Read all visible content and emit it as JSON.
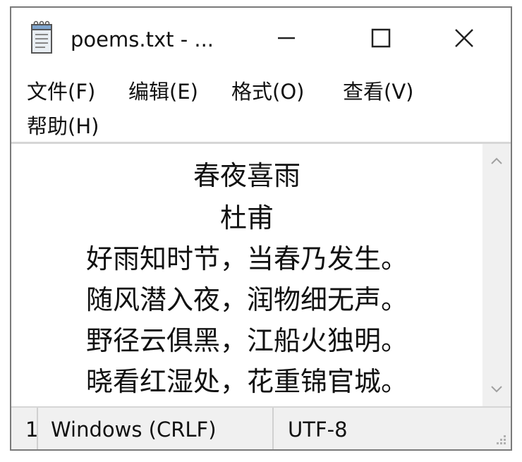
{
  "window": {
    "title": "poems.txt - ..."
  },
  "title_controls": {
    "minimize_icon": "minimize-icon",
    "maximize_icon": "maximize-icon",
    "close_icon": "close-icon"
  },
  "menu": {
    "items": [
      {
        "label": "文件(F)"
      },
      {
        "label": "编辑(E)"
      },
      {
        "label": "格式(O)"
      },
      {
        "label": "查看(V)"
      },
      {
        "label": "帮助(H)"
      }
    ]
  },
  "editor": {
    "lines": [
      "春夜喜雨",
      "杜甫",
      "好雨知时节，当春乃发生。",
      "随风潜入夜，润物细无声。",
      "野径云俱黑，江船火独明。",
      "晓看红湿处，花重锦官城。"
    ]
  },
  "status": {
    "position": "1",
    "line_ending": "Windows (CRLF)",
    "encoding": "UTF-8"
  },
  "colors": {
    "window_border": "#7a7a7a",
    "chrome_bg": "#f0f0f0",
    "text": "#111111"
  }
}
